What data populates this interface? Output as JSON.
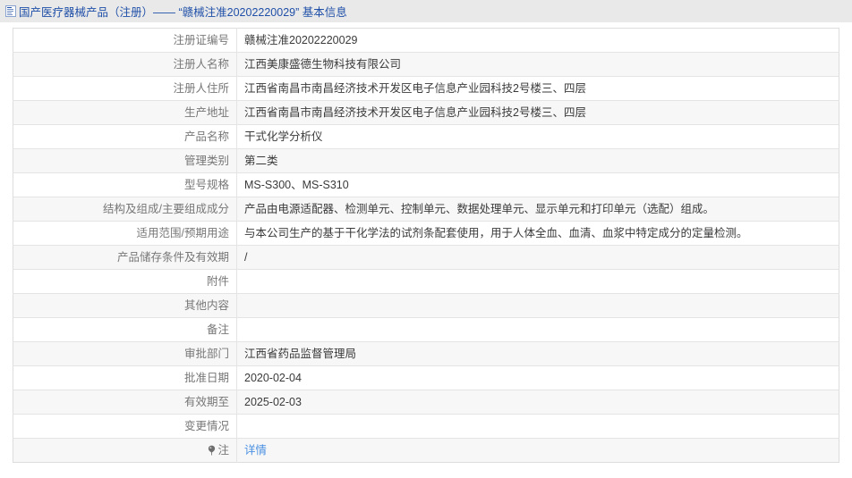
{
  "header": {
    "icon": "document-page-icon",
    "title": "国产医疗器械产品（注册）—— “赣械注准20202220029” 基本信息",
    "accent_color": "#1f4fa8",
    "background_color": "#e9e9e9"
  },
  "table": {
    "label_color": "#777777",
    "value_color": "#3a3a3a",
    "alt_row_color": "#f7f7f7",
    "border_color": "#e4e4e4",
    "rows": [
      {
        "label": "注册证编号",
        "value": "赣械注准20202220029"
      },
      {
        "label": "注册人名称",
        "value": "江西美康盛德生物科技有限公司"
      },
      {
        "label": "注册人住所",
        "value": "江西省南昌市南昌经济技术开发区电子信息产业园科技2号楼三、四层"
      },
      {
        "label": "生产地址",
        "value": "江西省南昌市南昌经济技术开发区电子信息产业园科技2号楼三、四层"
      },
      {
        "label": "产品名称",
        "value": "干式化学分析仪"
      },
      {
        "label": "管理类别",
        "value": "第二类"
      },
      {
        "label": "型号规格",
        "value": "MS-S300、MS-S310"
      },
      {
        "label": "结构及组成/主要组成成分",
        "value": "产品由电源适配器、检测单元、控制单元、数据处理单元、显示单元和打印单元（选配）组成。"
      },
      {
        "label": "适用范围/预期用途",
        "value": "与本公司生产的基于干化学法的试剂条配套使用，用于人体全血、血清、血浆中特定成分的定量检测。"
      },
      {
        "label": "产品储存条件及有效期",
        "value": "/"
      },
      {
        "label": "附件",
        "value": ""
      },
      {
        "label": "其他内容",
        "value": ""
      },
      {
        "label": "备注",
        "value": ""
      },
      {
        "label": "审批部门",
        "value": "江西省药品监督管理局"
      },
      {
        "label": "批准日期",
        "value": "2020-02-04"
      },
      {
        "label": "有效期至",
        "value": "2025-02-03"
      },
      {
        "label": "变更情况",
        "value": ""
      }
    ],
    "note_row": {
      "icon": "note-balloon-icon",
      "label": "注",
      "link_label": "详情",
      "link_color": "#4a90e2"
    }
  }
}
